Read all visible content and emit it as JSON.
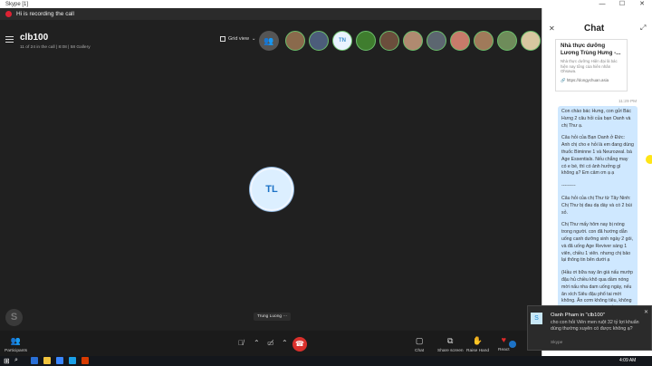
{
  "window": {
    "title": "Skype [1]",
    "controls": [
      "—",
      "☐",
      "✕"
    ]
  },
  "recording": {
    "text": "Hi is recording the call"
  },
  "call": {
    "title": "clb100",
    "subtitle": "11 of 24 in the call | 8:08 | 58 Gallery",
    "grid_view_label": "Grid view",
    "grid_view_chevron": "⌄",
    "main_tile_initials": "TL",
    "speaker_chip": "Trung Luong ⋯",
    "add_people_icon": "add-people-icon",
    "participants": [
      {
        "initials": "",
        "bg": "#8a6a4c"
      },
      {
        "initials": "",
        "bg": "#4c5d7a"
      },
      {
        "initials": "TN",
        "bg": "#e9f3ff"
      },
      {
        "initials": "",
        "bg": "#3f7d2e"
      },
      {
        "initials": "",
        "bg": "#6b4e3c"
      },
      {
        "initials": "",
        "bg": "#b08a70"
      },
      {
        "initials": "",
        "bg": "#5c6670"
      },
      {
        "initials": "",
        "bg": "#c77b6a"
      },
      {
        "initials": "",
        "bg": "#a07a5a"
      },
      {
        "initials": "",
        "bg": "#6e8c5a"
      },
      {
        "initials": "",
        "bg": "#d8c7a0"
      }
    ]
  },
  "controls": {
    "participants_label": "Participants",
    "mic_icon": "mic-muted-icon",
    "video_icon": "video-off-icon",
    "hangup_icon": "hang-up-icon",
    "chat_label": "Chat",
    "share_label": "Share screen",
    "raise_hand_label": "Raise Hand",
    "react_label": "React",
    "chevron": "⌃",
    "more": "⋯"
  },
  "chat": {
    "title": "Chat",
    "card_title": "Nhà thực dưỡng Lương Trùng Hưng -...",
    "card_desc": "Nhà thực dưỡng Hiện đại là bác hiện nay tổng của hiên nhân Ohsawa.",
    "card_link": "https://dongychuan.asia",
    "timestamp": "11:29 PM",
    "message_paragraphs": [
      "Con chào bác Hưng, con gửi Bác Hưng 2 câu hỏi của bạn Oanh và chị Thư ạ.",
      "Câu hỏi của Bạn Oanh ở Đức: Anh chị cho e hỏi là em  đang dùng thuốc Biminne 1 và Neurozeal. bà Age Essentials. Nếu chẳng may có e bé, thì có ảnh hưởng gì không ạ? Em cảm ơn ạ ạ",
      "---------",
      "Câu hỏi của chị  Thư từ Tây Ninh: Chị  Thư bị đau dạ dày và có 2 bùi sỏ.",
      "Chị  Thư mấy hôm nay bị nóng trong người.  con đã hướng dẫn uống canh dưỡng sinh ngày 2 gói, và đã uống Age Reviver sáng 1 viên, chiều 1 viên. nhưng chị bảo lại thông tin bên dưới ạ",
      "(Hầu ơi bữa nay ăn giá nấu mướp đậu hủ chiều khô qua dầm nóng mời nấu nha dam uống ngày, nếu ăn xích Siêu đậu phổ tai mới không. Ăn cơm không tiêu, không đói bụng, không đáp chất nghe"
    ]
  },
  "notification": {
    "title": "Oanh Pham in \"clb100\"",
    "body": "cho con hỏi Viên men ruột 32 tỷ lợi khuẩn dùng thường xuyên có được không ạ?",
    "app": "Skype",
    "close": "✕"
  },
  "taskbar": {
    "clock": "4:09 AM"
  },
  "colors": {
    "hangup": "#d9302c",
    "accent": "#1c72c6",
    "bubble": "#cfe8ff",
    "recording": "#dd2233"
  }
}
